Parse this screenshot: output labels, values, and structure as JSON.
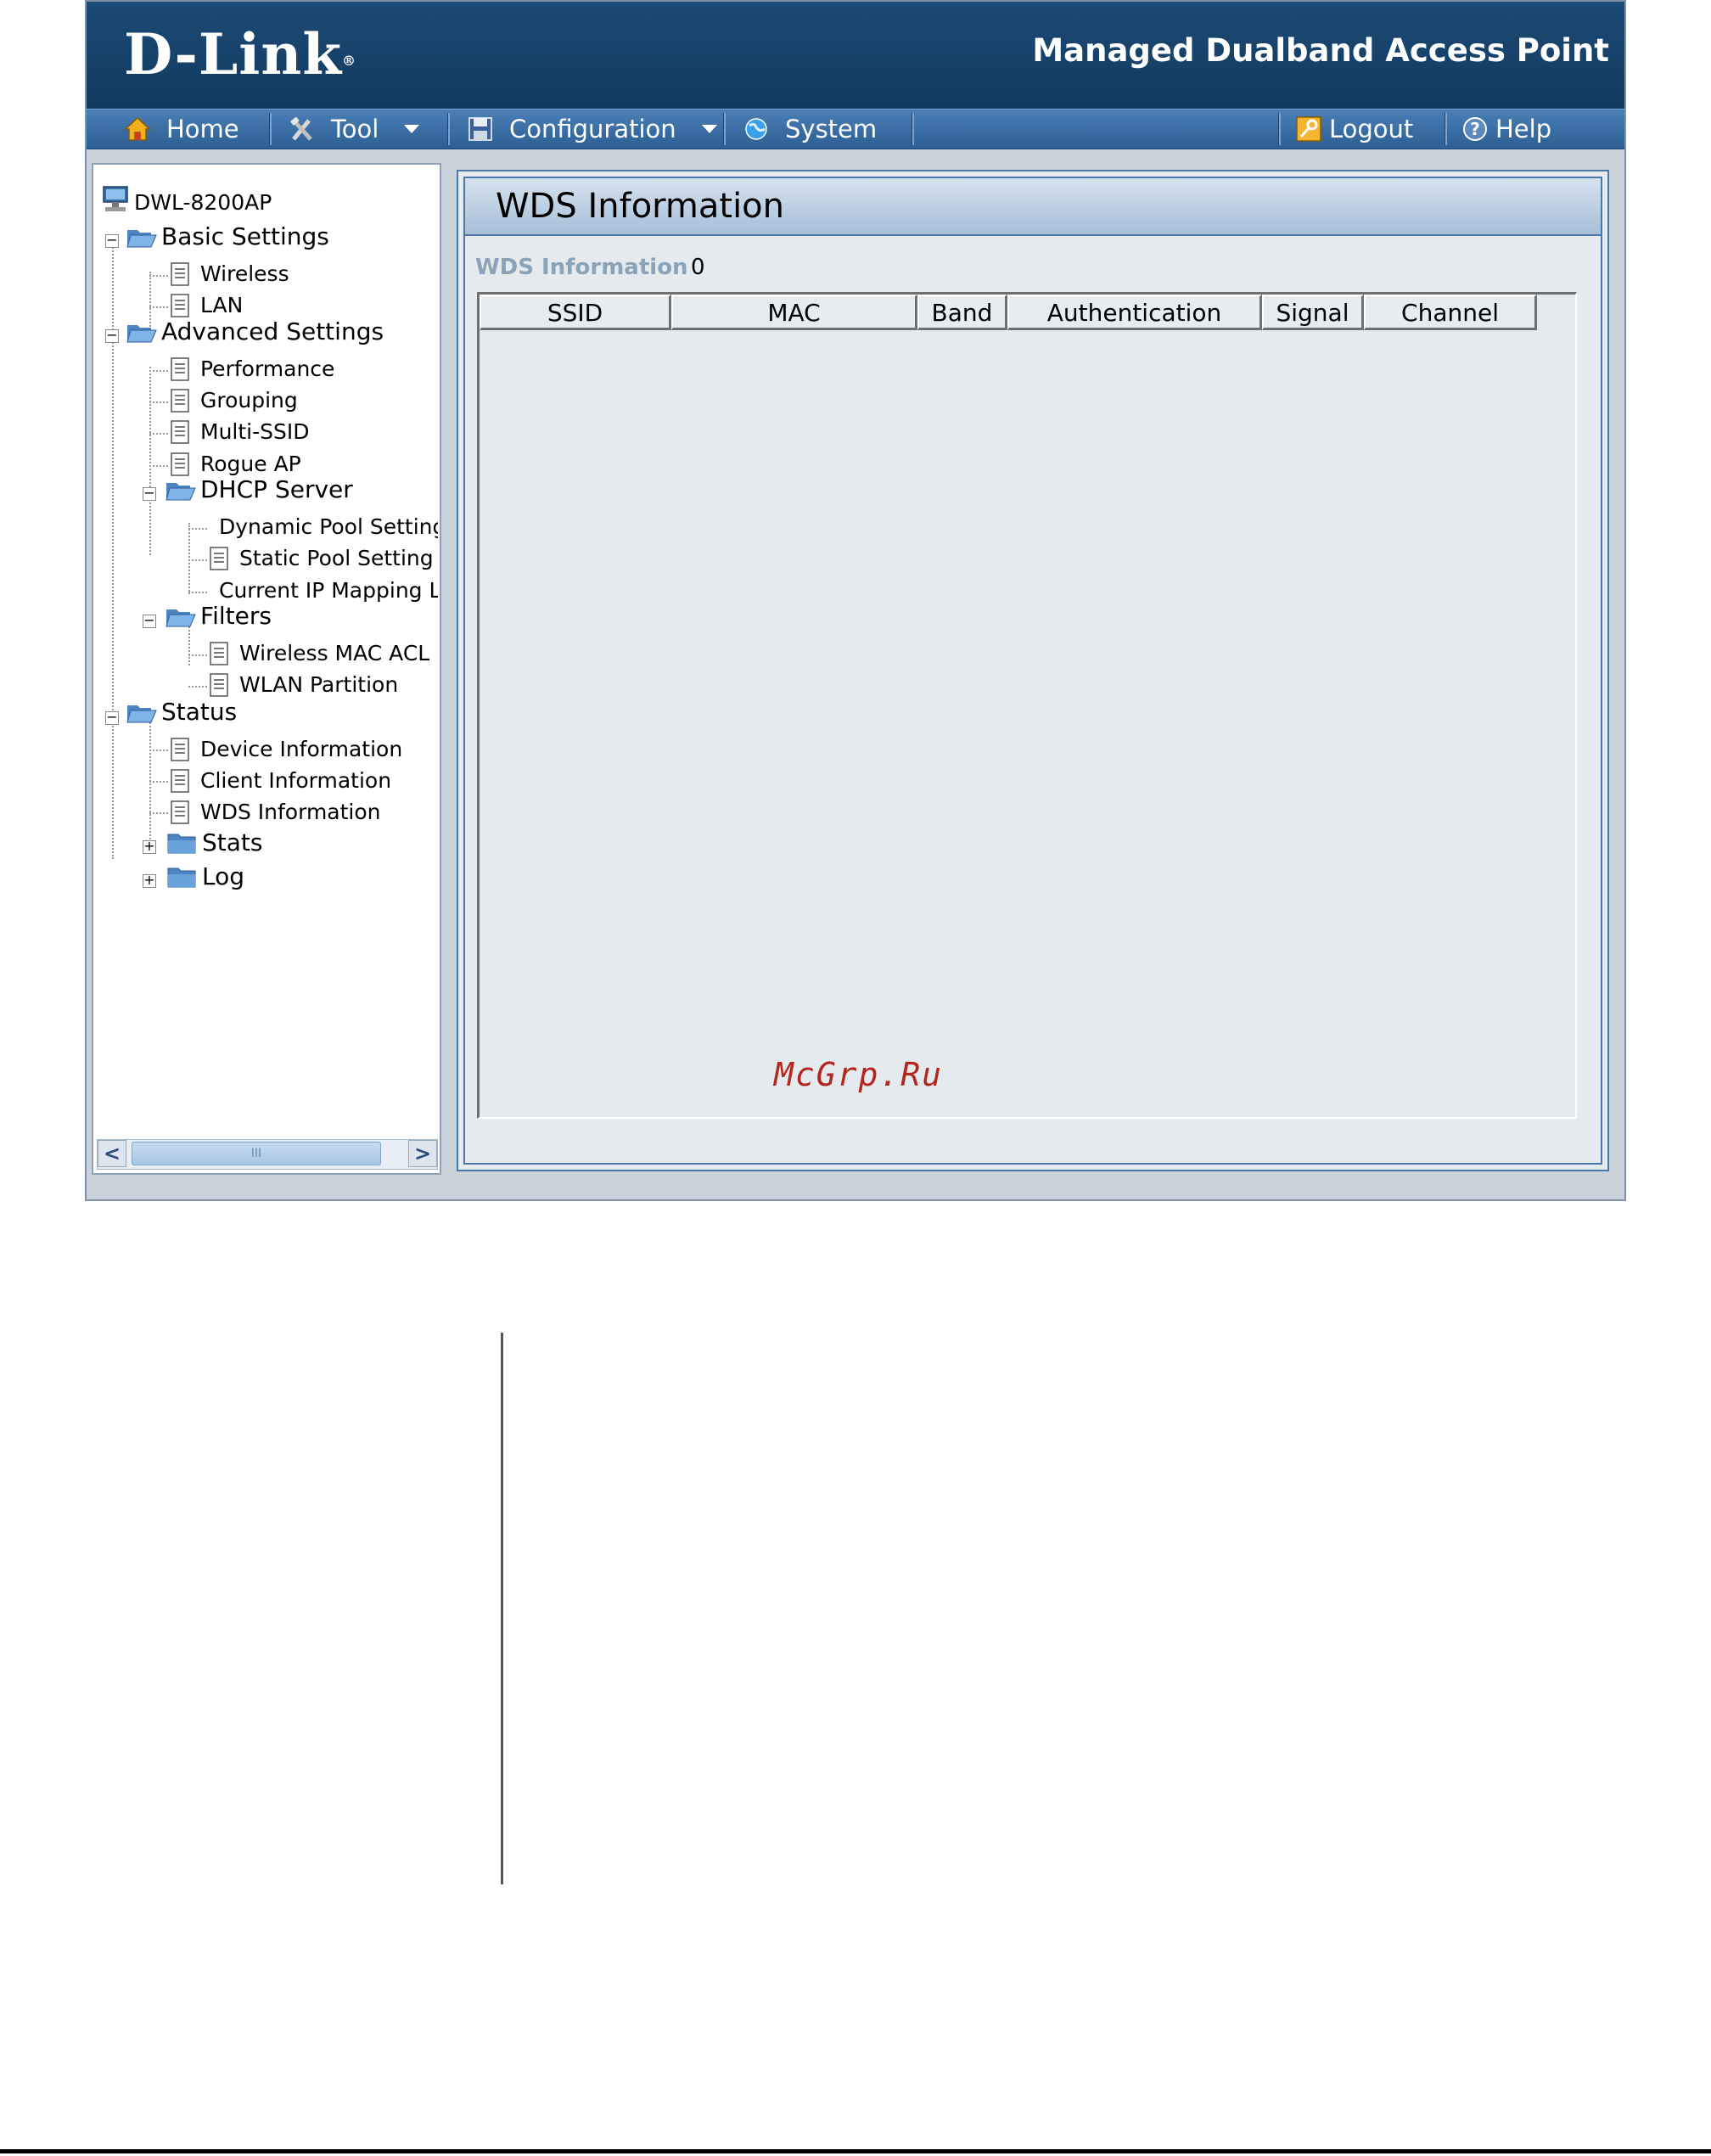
{
  "header": {
    "logo": "D-Link",
    "logo_mark": "®",
    "product": "Managed Dualband Access Point"
  },
  "menu": {
    "home": "Home",
    "tool": "Tool",
    "configuration": "Configuration",
    "system": "System",
    "logout": "Logout",
    "help": "Help"
  },
  "tree": {
    "root": "DWL-8200AP",
    "basic": "Basic Settings",
    "wireless": "Wireless",
    "lan": "LAN",
    "advanced": "Advanced Settings",
    "performance": "Performance",
    "grouping": "Grouping",
    "multissid": "Multi-SSID",
    "rogue": "Rogue AP",
    "dhcp": "DHCP Server",
    "dynamic_pool": "Dynamic Pool Setting",
    "static_pool": "Static Pool Setting",
    "current_ip": "Current IP Mapping L",
    "filters": "Filters",
    "mac_acl": "Wireless MAC ACL",
    "wlan_partition": "WLAN Partition",
    "status": "Status",
    "device_info": "Device Information",
    "client_info": "Client Information",
    "wds_info": "WDS Information",
    "stats": "Stats",
    "log": "Log",
    "scroll_grip": "III"
  },
  "content": {
    "title": "WDS Information",
    "info_label": "WDS Information",
    "info_value": "0",
    "columns": [
      "SSID",
      "MAC",
      "Band",
      "Authentication",
      "Signal",
      "Channel"
    ]
  },
  "watermark": "McGrp.Ru",
  "colors": {
    "header_bg": "#123a60",
    "menubar": "#2c5f94",
    "panel_border": "#4b78a8",
    "watermark": "#b3261e"
  }
}
